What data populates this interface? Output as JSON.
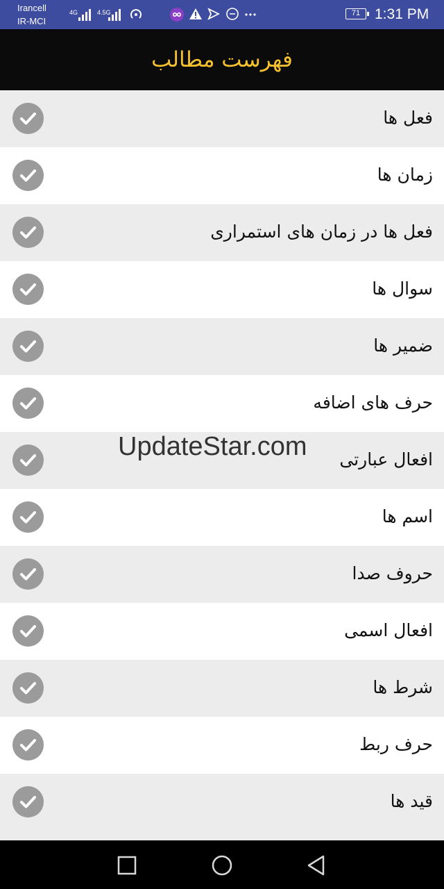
{
  "status_bar": {
    "carrier_1": "Irancell",
    "carrier_2": "IR-MCI",
    "network_1": "4G",
    "network_2": "4.5G",
    "battery_level": "71",
    "time": "1:31 PM"
  },
  "app_bar": {
    "title": "فهرست مطالب"
  },
  "list": {
    "items": [
      {
        "label": "فعل ها"
      },
      {
        "label": "زمان ها"
      },
      {
        "label": "فعل ها در زمان های استمراری"
      },
      {
        "label": "سوال ها"
      },
      {
        "label": "ضمیر ها"
      },
      {
        "label": "حرف های اضافه"
      },
      {
        "label": "افعال عبارتی"
      },
      {
        "label": "اسم ها"
      },
      {
        "label": "حروف صدا"
      },
      {
        "label": "افعال اسمی"
      },
      {
        "label": "شرط ها"
      },
      {
        "label": "حرف ربط"
      },
      {
        "label": "قید ها"
      }
    ]
  },
  "watermark": "UpdateStar.com",
  "colors": {
    "status_bar": "#3d4c9f",
    "app_bar": "#0b0b0b",
    "title": "#f5c12e",
    "row_alt": "#ececec",
    "check": "#9b9b9b"
  }
}
